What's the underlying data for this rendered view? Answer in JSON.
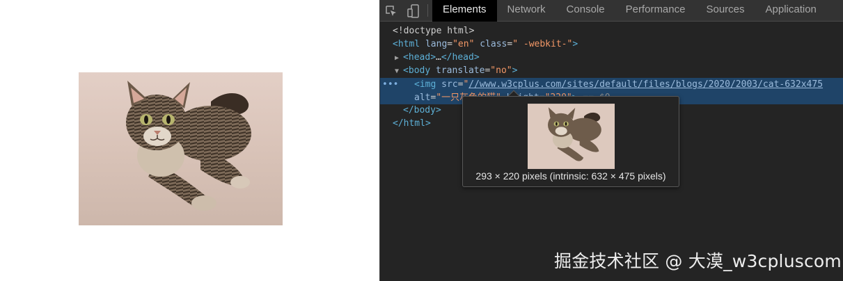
{
  "page": {
    "image_alt": "一只灰色的猫"
  },
  "devtools": {
    "tabs": [
      "Elements",
      "Network",
      "Console",
      "Performance",
      "Sources",
      "Application"
    ],
    "active_tab": "Elements",
    "icons": [
      "inspect-element-icon",
      "device-toolbar-icon"
    ],
    "dom": {
      "doctype": "<!doctype html>",
      "html_open_tag": "html",
      "html_lang_attr": "lang",
      "html_lang_value": "\"en\"",
      "html_class_attr": "class",
      "html_class_value": "\" -webkit-\"",
      "head_collapsed": "head",
      "head_ellipsis": "…",
      "body_tag": "body",
      "body_attr": "translate",
      "body_attr_value": "\"no\"",
      "img_tag": "img",
      "img_src_attr": "src",
      "img_src_value": "//www.w3cplus.com/sites/default/files/blogs/2020/2003/cat-632x475",
      "img_alt_attr": "alt",
      "img_alt_value_visible": "\"一只灰色的猫\"",
      "img_height_attr_visible": "height",
      "img_height_value_visible": "\"220\"",
      "img_dollar": "== $0",
      "body_close": "/body",
      "html_close": "/html"
    },
    "tooltip": {
      "text": "293 × 220 pixels (intrinsic: 632 × 475 pixels)"
    }
  },
  "watermark": "掘金技术社区 @ 大漠_w3cpluscom",
  "colors": {
    "devtools_bg": "#242424",
    "selected_row": "#1f4468",
    "tag": "#5db0d7",
    "attr_value": "#f29766"
  }
}
